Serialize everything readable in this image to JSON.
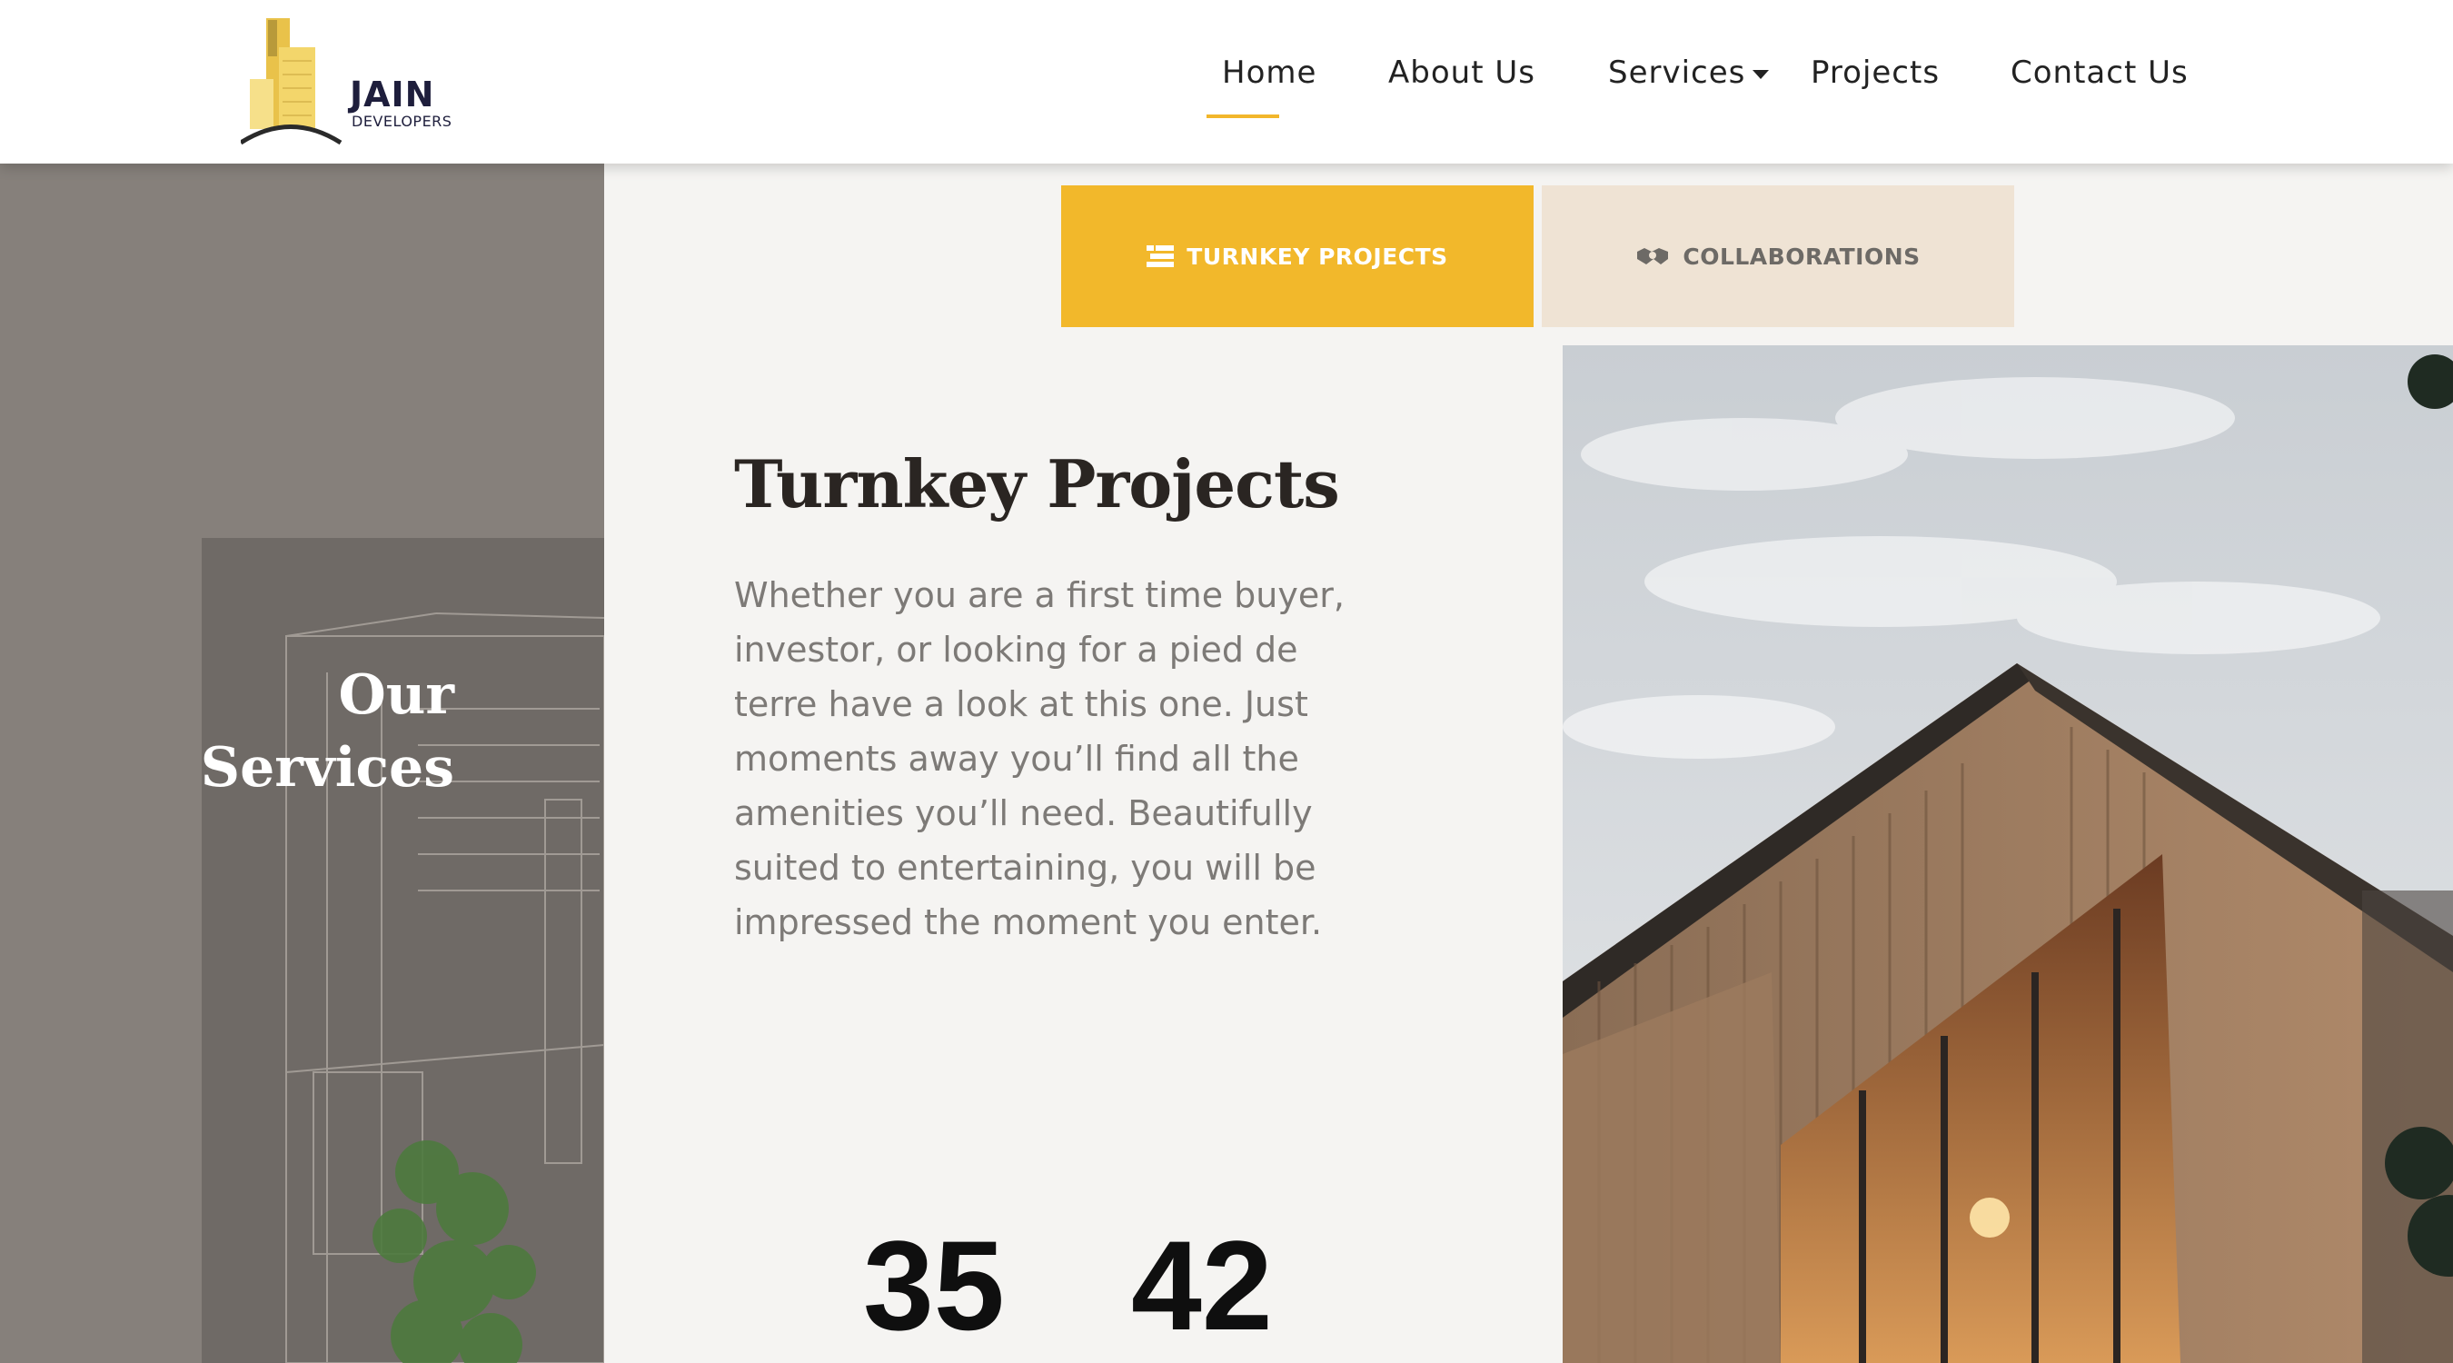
{
  "logo": {
    "name": "JAIN",
    "subtitle": "DEVELOPERS"
  },
  "nav": {
    "items": [
      {
        "label": "Home",
        "active": true
      },
      {
        "label": "About Us"
      },
      {
        "label": "Services",
        "has_dropdown": true
      },
      {
        "label": "Projects"
      },
      {
        "label": "Contact Us"
      }
    ]
  },
  "left_panel": {
    "title_line1": "Our",
    "title_line2": "Services"
  },
  "tabs": [
    {
      "label": "TURNKEY PROJECTS",
      "icon": "list-icon",
      "active": true
    },
    {
      "label": "COLLABORATIONS",
      "icon": "handshake-icon",
      "active": false
    }
  ],
  "content": {
    "title": "Turnkey Projects",
    "description": "Whether you are a first time buyer, investor, or looking for a pied de terre have a look at this one. Just moments away you’ll find all the amenities you’ll need. Beautifully suited to entertaining, you will be impressed the moment you enter."
  },
  "stats": [
    "35",
    "42"
  ],
  "colors": {
    "accent": "#f2b82b",
    "collab_tab_bg": "#efe3d4",
    "left_panel_bg": "#86807b",
    "page_bg": "#f5f4f2"
  }
}
